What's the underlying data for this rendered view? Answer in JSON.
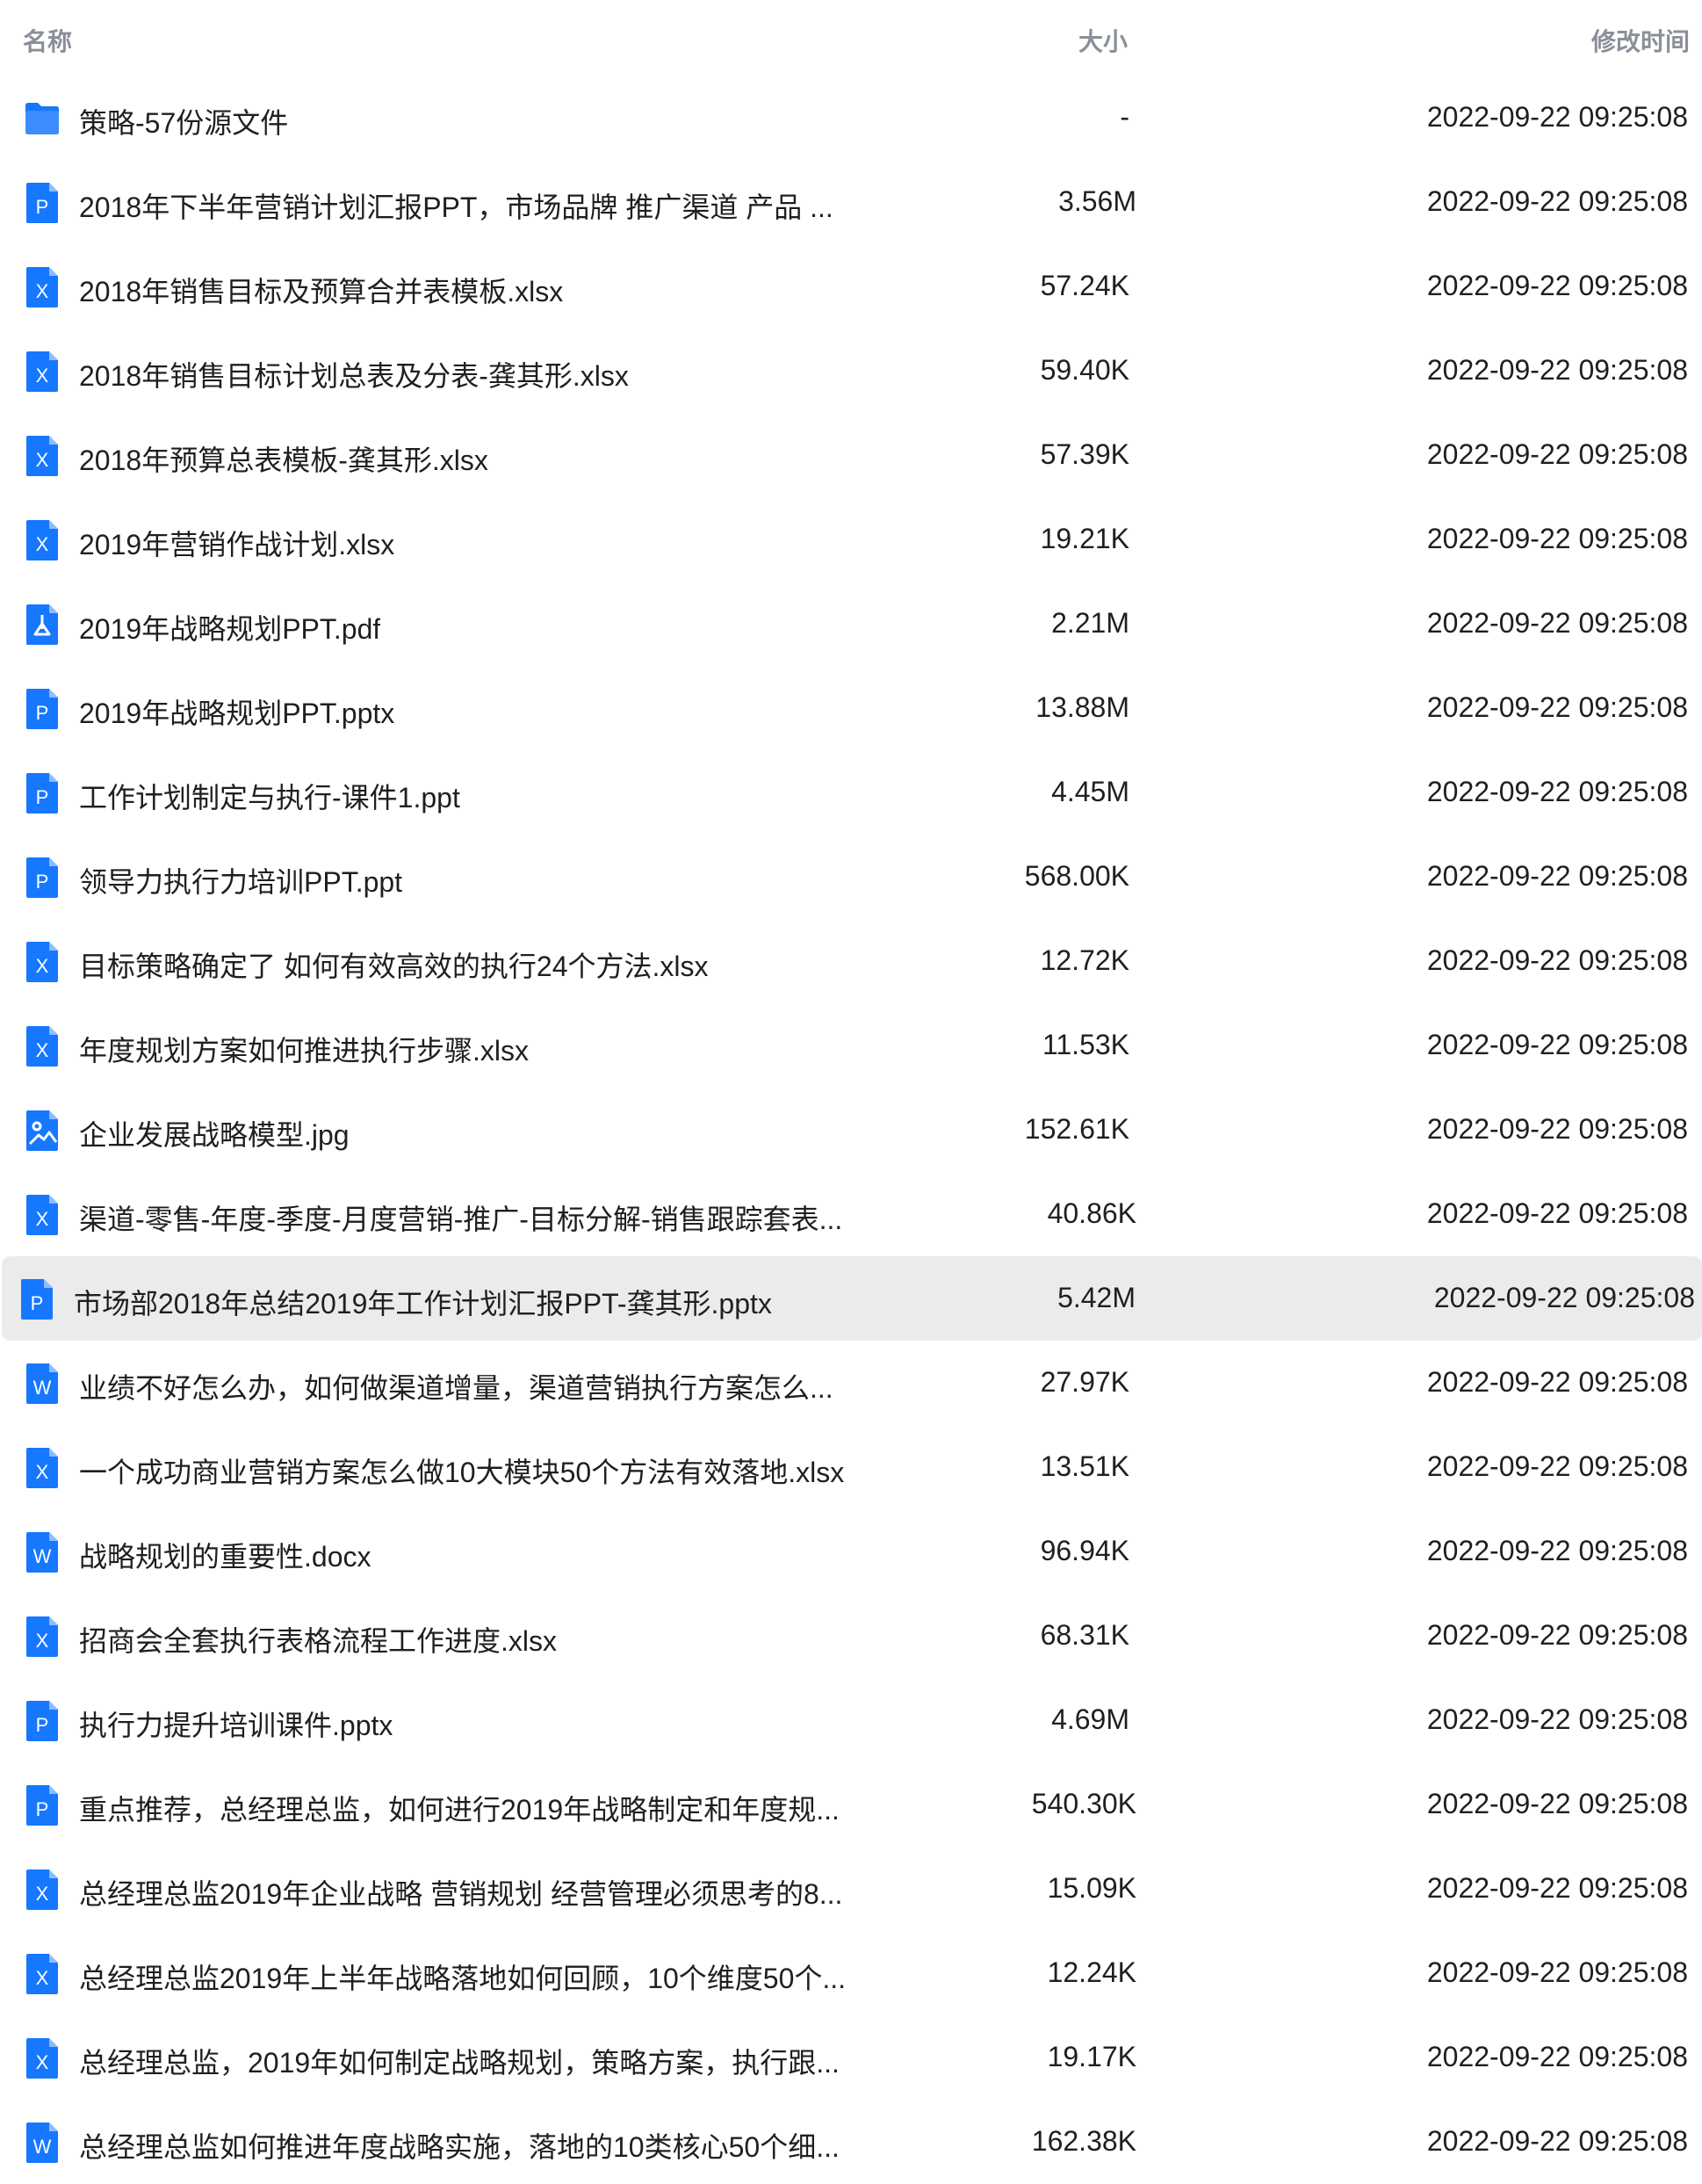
{
  "columns": {
    "name": "名称",
    "size": "大小",
    "modified": "修改时间"
  },
  "colors": {
    "header_text": "#8a8f99",
    "icon_blue": "#1677ff",
    "selected_row_bg": "#ebebeb"
  },
  "files": [
    {
      "icon": "folder-icon",
      "glyph": "",
      "name": "策略-57份源文件",
      "size": "-",
      "modified": "2022-09-22 09:25:08"
    },
    {
      "icon": "ppt-file-icon",
      "glyph": "P",
      "name": "2018年下半年营销计划汇报PPT，市场品牌 推广渠道 产品 ...",
      "size": "3.56M",
      "modified": "2022-09-22 09:25:08"
    },
    {
      "icon": "excel-file-icon",
      "glyph": "X",
      "name": "2018年销售目标及预算合并表模板.xlsx",
      "size": "57.24K",
      "modified": "2022-09-22 09:25:08"
    },
    {
      "icon": "excel-file-icon",
      "glyph": "X",
      "name": "2018年销售目标计划总表及分表-龚其形.xlsx",
      "size": "59.40K",
      "modified": "2022-09-22 09:25:08"
    },
    {
      "icon": "excel-file-icon",
      "glyph": "X",
      "name": "2018年预算总表模板-龚其形.xlsx",
      "size": "57.39K",
      "modified": "2022-09-22 09:25:08"
    },
    {
      "icon": "excel-file-icon",
      "glyph": "X",
      "name": "2019年营销作战计划.xlsx",
      "size": "19.21K",
      "modified": "2022-09-22 09:25:08"
    },
    {
      "icon": "pdf-file-icon",
      "glyph": "",
      "name": "2019年战略规划PPT.pdf",
      "size": "2.21M",
      "modified": "2022-09-22 09:25:08"
    },
    {
      "icon": "ppt-file-icon",
      "glyph": "P",
      "name": "2019年战略规划PPT.pptx",
      "size": "13.88M",
      "modified": "2022-09-22 09:25:08"
    },
    {
      "icon": "ppt-file-icon",
      "glyph": "P",
      "name": "工作计划制定与执行-课件1.ppt",
      "size": "4.45M",
      "modified": "2022-09-22 09:25:08"
    },
    {
      "icon": "ppt-file-icon",
      "glyph": "P",
      "name": "领导力执行力培训PPT.ppt",
      "size": "568.00K",
      "modified": "2022-09-22 09:25:08"
    },
    {
      "icon": "excel-file-icon",
      "glyph": "X",
      "name": "目标策略确定了 如何有效高效的执行24个方法.xlsx",
      "size": "12.72K",
      "modified": "2022-09-22 09:25:08"
    },
    {
      "icon": "excel-file-icon",
      "glyph": "X",
      "name": "年度规划方案如何推进执行步骤.xlsx",
      "size": "11.53K",
      "modified": "2022-09-22 09:25:08"
    },
    {
      "icon": "image-file-icon",
      "glyph": "",
      "name": "企业发展战略模型.jpg",
      "size": "152.61K",
      "modified": "2022-09-22 09:25:08"
    },
    {
      "icon": "excel-file-icon",
      "glyph": "X",
      "name": "渠道-零售-年度-季度-月度营销-推广-目标分解-销售跟踪套表...",
      "size": "40.86K",
      "modified": "2022-09-22 09:25:08"
    },
    {
      "icon": "ppt-file-icon",
      "glyph": "P",
      "name": "市场部2018年总结2019年工作计划汇报PPT-龚其形.pptx",
      "size": "5.42M",
      "modified": "2022-09-22 09:25:08",
      "selected": true
    },
    {
      "icon": "word-file-icon",
      "glyph": "W",
      "name": "业绩不好怎么办，如何做渠道增量，渠道营销执行方案怎么...",
      "size": "27.97K",
      "modified": "2022-09-22 09:25:08"
    },
    {
      "icon": "excel-file-icon",
      "glyph": "X",
      "name": "一个成功商业营销方案怎么做10大模块50个方法有效落地.xlsx",
      "size": "13.51K",
      "modified": "2022-09-22 09:25:08"
    },
    {
      "icon": "word-file-icon",
      "glyph": "W",
      "name": "战略规划的重要性.docx",
      "size": "96.94K",
      "modified": "2022-09-22 09:25:08"
    },
    {
      "icon": "excel-file-icon",
      "glyph": "X",
      "name": "招商会全套执行表格流程工作进度.xlsx",
      "size": "68.31K",
      "modified": "2022-09-22 09:25:08"
    },
    {
      "icon": "ppt-file-icon",
      "glyph": "P",
      "name": "执行力提升培训课件.pptx",
      "size": "4.69M",
      "modified": "2022-09-22 09:25:08"
    },
    {
      "icon": "ppt-file-icon",
      "glyph": "P",
      "name": "重点推荐，总经理总监，如何进行2019年战略制定和年度规...",
      "size": "540.30K",
      "modified": "2022-09-22 09:25:08"
    },
    {
      "icon": "excel-file-icon",
      "glyph": "X",
      "name": "总经理总监2019年企业战略 营销规划 经营管理必须思考的8...",
      "size": "15.09K",
      "modified": "2022-09-22 09:25:08"
    },
    {
      "icon": "excel-file-icon",
      "glyph": "X",
      "name": "总经理总监2019年上半年战略落地如何回顾，10个维度50个...",
      "size": "12.24K",
      "modified": "2022-09-22 09:25:08"
    },
    {
      "icon": "excel-file-icon",
      "glyph": "X",
      "name": "总经理总监，2019年如何制定战略规划，策略方案，执行跟...",
      "size": "19.17K",
      "modified": "2022-09-22 09:25:08"
    },
    {
      "icon": "word-file-icon",
      "glyph": "W",
      "name": "总经理总监如何推进年度战略实施，落地的10类核心50个细...",
      "size": "162.38K",
      "modified": "2022-09-22 09:25:08"
    }
  ]
}
